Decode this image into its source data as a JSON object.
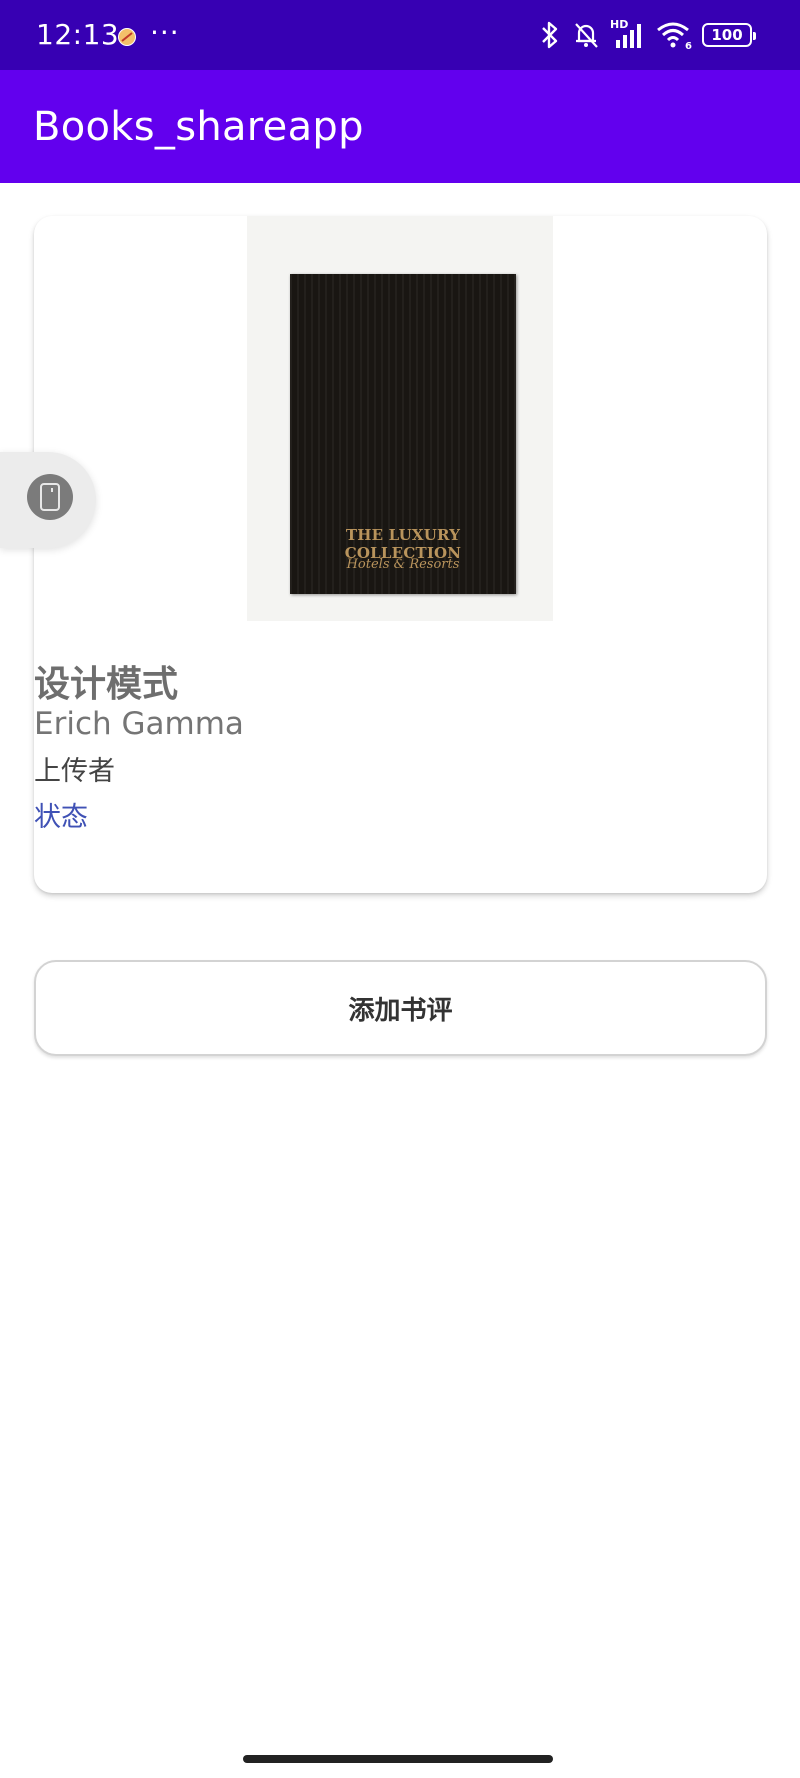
{
  "status_bar": {
    "time": "12:13",
    "more": "···",
    "battery": "100",
    "network_label": "HD",
    "wifi_sub": "6"
  },
  "app_bar": {
    "title": "Books_shareapp"
  },
  "book": {
    "cover_line1": "THE LUXURY COLLECTION",
    "cover_line2": "Hotels & Resorts",
    "title": "设计模式",
    "author": "Erich Gamma",
    "uploader": "上传者",
    "status": "状态"
  },
  "actions": {
    "add_review": "添加书评"
  },
  "colors": {
    "status_bar": "#3700b3",
    "app_bar": "#6200ee",
    "status_text": "#3f51b5"
  }
}
